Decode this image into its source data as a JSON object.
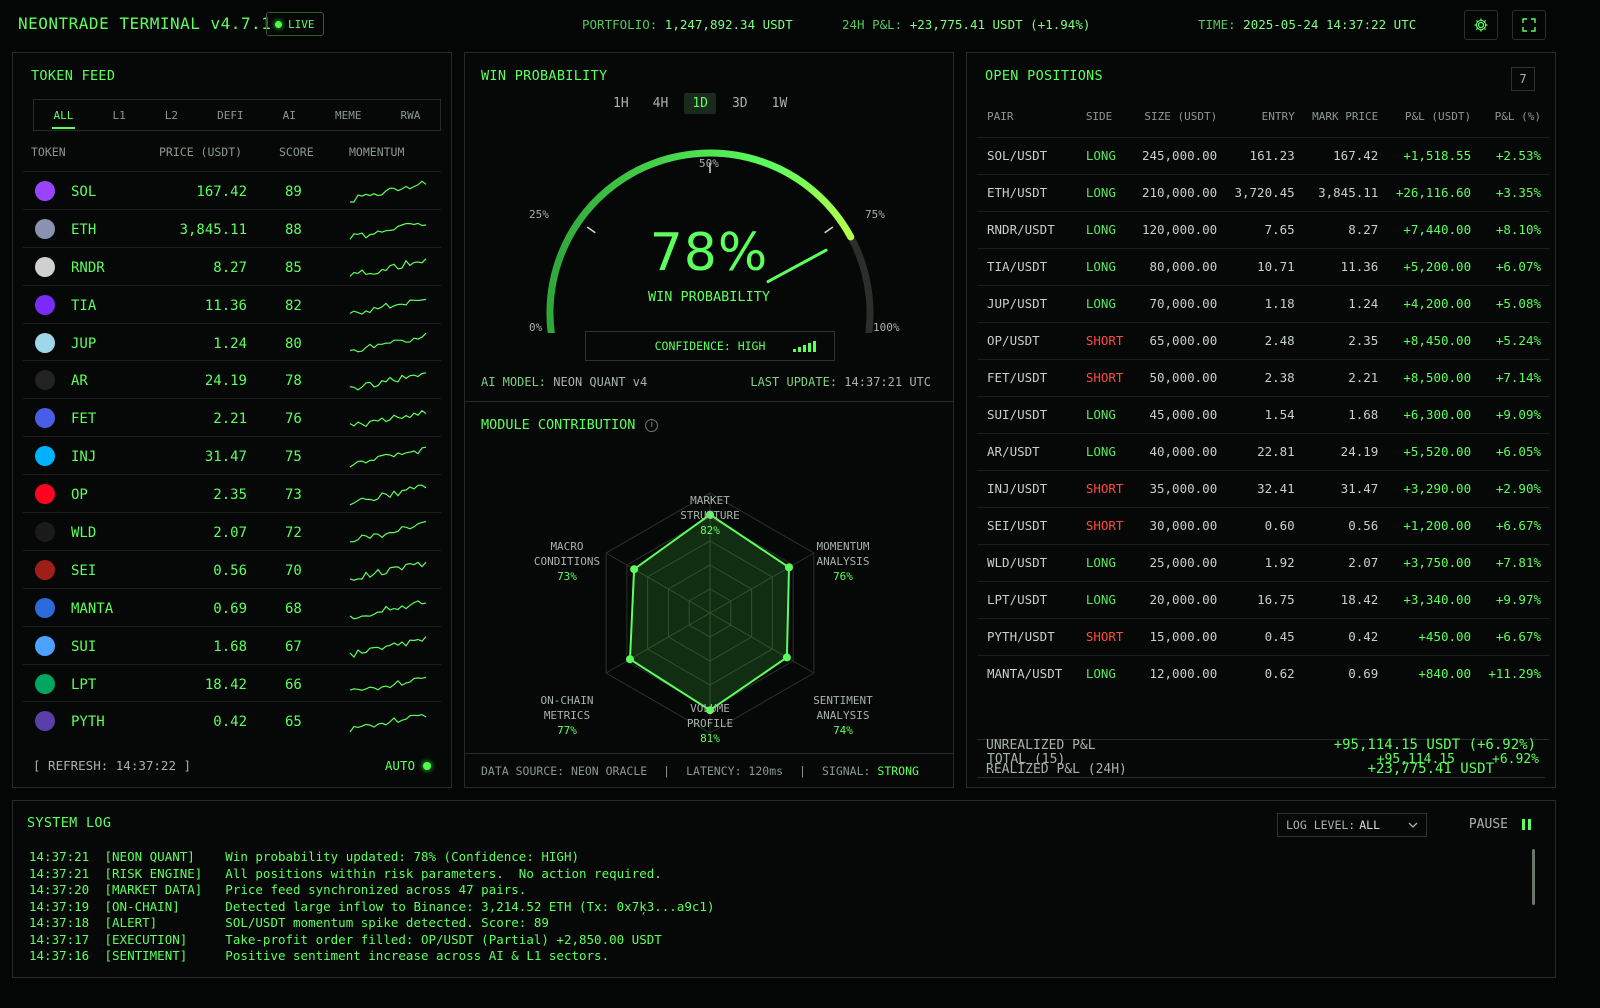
{
  "header": {
    "title": "NEONTRADE TERMINAL v4.7.1",
    "live": "LIVE",
    "portfolio_label": "PORTFOLIO:",
    "portfolio_value": "1,247,892.34 USDT",
    "pnl_label": "24H P&L:",
    "pnl_value": "+23,775.41 USDT (+1.94%)",
    "time_label": "TIME:",
    "time_value": "2025-05-24 14:37:22 UTC",
    "icons": [
      "gear-icon",
      "fullscreen-icon"
    ]
  },
  "token_feed": {
    "title": "TOKEN FEED",
    "tabs": [
      "ALL",
      "L1",
      "L2",
      "DEFI",
      "AI",
      "MEME",
      "RWA"
    ],
    "active_tab": "ALL",
    "columns": [
      "TOKEN",
      "PRICE (USDT)",
      "SCORE",
      "MOMENTUM"
    ],
    "rows": [
      {
        "name": "SOL",
        "price": "167.42",
        "score": "89",
        "color": "#9945ff"
      },
      {
        "name": "ETH",
        "price": "3,845.11",
        "score": "88",
        "color": "#8a92b2"
      },
      {
        "name": "RNDR",
        "price": "8.27",
        "score": "85",
        "color": "#d0d0d0"
      },
      {
        "name": "TIA",
        "price": "11.36",
        "score": "82",
        "color": "#7b2bf9"
      },
      {
        "name": "JUP",
        "price": "1.24",
        "score": "80",
        "color": "#9fd7e8"
      },
      {
        "name": "AR",
        "price": "24.19",
        "score": "78",
        "color": "#222222"
      },
      {
        "name": "FET",
        "price": "2.21",
        "score": "76",
        "color": "#4a5de8"
      },
      {
        "name": "INJ",
        "price": "31.47",
        "score": "75",
        "color": "#00b2ff"
      },
      {
        "name": "OP",
        "price": "2.35",
        "score": "73",
        "color": "#ff0420"
      },
      {
        "name": "WLD",
        "price": "2.07",
        "score": "72",
        "color": "#1a1a1a"
      },
      {
        "name": "SEI",
        "price": "0.56",
        "score": "70",
        "color": "#9e1f19"
      },
      {
        "name": "MANTA",
        "price": "0.69",
        "score": "68",
        "color": "#2a6bdb"
      },
      {
        "name": "SUI",
        "price": "1.68",
        "score": "67",
        "color": "#4da2ff"
      },
      {
        "name": "LPT",
        "price": "18.42",
        "score": "66",
        "color": "#00a55f"
      },
      {
        "name": "PYTH",
        "price": "0.42",
        "score": "65",
        "color": "#5a3fa8"
      }
    ],
    "refresh": "[ REFRESH: 14:37:22 ]",
    "auto": "AUTO"
  },
  "win_probability": {
    "title": "WIN PROBABILITY",
    "timeframes": [
      "1H",
      "4H",
      "1D",
      "3D",
      "1W"
    ],
    "active_timeframe": "1D",
    "value": 78,
    "value_text": "78%",
    "label": "WIN PROBABILITY",
    "scale": [
      "0%",
      "25%",
      "50%",
      "75%",
      "100%"
    ],
    "confidence": "CONFIDENCE: HIGH",
    "model_label": "AI MODEL:",
    "model_value": "NEON QUANT v4",
    "update_label": "LAST UPDATE:",
    "update_value": "14:37:21 UTC"
  },
  "module_contribution": {
    "title": "MODULE CONTRIBUTION",
    "modules": [
      {
        "name1": "MARKET",
        "name2": "STRUCTURE",
        "value": 82,
        "pct": "82%"
      },
      {
        "name1": "MOMENTUM",
        "name2": "ANALYSIS",
        "value": 76,
        "pct": "76%"
      },
      {
        "name1": "SENTIMENT",
        "name2": "ANALYSIS",
        "value": 74,
        "pct": "74%"
      },
      {
        "name1": "VOLUME",
        "name2": "PROFILE",
        "value": 81,
        "pct": "81%"
      },
      {
        "name1": "ON-CHAIN",
        "name2": "METRICS",
        "value": 77,
        "pct": "77%"
      },
      {
        "name1": "MACRO",
        "name2": "CONDITIONS",
        "value": 73,
        "pct": "73%"
      }
    ],
    "footer_source": "DATA SOURCE: NEON ORACLE",
    "footer_latency": "LATENCY: 120ms",
    "footer_signal_label": "SIGNAL:",
    "footer_signal_value": "STRONG",
    "sep": "|"
  },
  "open_positions": {
    "title": "OPEN POSITIONS",
    "count": "7",
    "columns": [
      "PAIR",
      "SIDE",
      "SIZE (USDT)",
      "ENTRY",
      "MARK PRICE",
      "P&L (USDT)",
      "P&L (%)"
    ],
    "rows": [
      [
        "SOL/USDT",
        "LONG",
        "245,000.00",
        "161.23",
        "167.42",
        "+1,518.55",
        "+2.53%"
      ],
      [
        "ETH/USDT",
        "LONG",
        "210,000.00",
        "3,720.45",
        "3,845.11",
        "+26,116.60",
        "+3.35%"
      ],
      [
        "RNDR/USDT",
        "LONG",
        "120,000.00",
        "7.65",
        "8.27",
        "+7,440.00",
        "+8.10%"
      ],
      [
        "TIA/USDT",
        "LONG",
        "80,000.00",
        "10.71",
        "11.36",
        "+5,200.00",
        "+6.07%"
      ],
      [
        "JUP/USDT",
        "LONG",
        "70,000.00",
        "1.18",
        "1.24",
        "+4,200.00",
        "+5.08%"
      ],
      [
        "OP/USDT",
        "SHORT",
        "65,000.00",
        "2.48",
        "2.35",
        "+8,450.00",
        "+5.24%"
      ],
      [
        "FET/USDT",
        "SHORT",
        "50,000.00",
        "2.38",
        "2.21",
        "+8,500.00",
        "+7.14%"
      ],
      [
        "SUI/USDT",
        "LONG",
        "45,000.00",
        "1.54",
        "1.68",
        "+6,300.00",
        "+9.09%"
      ],
      [
        "AR/USDT",
        "LONG",
        "40,000.00",
        "22.81",
        "24.19",
        "+5,520.00",
        "+6.05%"
      ],
      [
        "INJ/USDT",
        "SHORT",
        "35,000.00",
        "32.41",
        "31.47",
        "+3,290.00",
        "+2.90%"
      ],
      [
        "SEI/USDT",
        "SHORT",
        "30,000.00",
        "0.60",
        "0.56",
        "+1,200.00",
        "+6.67%"
      ],
      [
        "WLD/USDT",
        "LONG",
        "25,000.00",
        "1.92",
        "2.07",
        "+3,750.00",
        "+7.81%"
      ],
      [
        "LPT/USDT",
        "LONG",
        "20,000.00",
        "16.75",
        "18.42",
        "+3,340.00",
        "+9.97%"
      ],
      [
        "PYTH/USDT",
        "SHORT",
        "15,000.00",
        "0.45",
        "0.42",
        "+450.00",
        "+6.67%"
      ],
      [
        "MANTA/USDT",
        "LONG",
        "12,000.00",
        "0.62",
        "0.69",
        "+840.00",
        "+11.29%"
      ]
    ],
    "total_label": "TOTAL (15)",
    "total_pnl": "+95,114.15",
    "total_pct": "+6.92%",
    "unrealized_label": "UNREALIZED P&L",
    "unrealized_value": "+95,114.15 USDT (+6.92%)",
    "realized_label": "REALIZED P&L (24H)",
    "realized_value": "+23,775.41 USDT"
  },
  "system_log": {
    "title": "SYSTEM LOG",
    "log_level_label": "LOG LEVEL:",
    "log_level_value": "ALL",
    "pause": "PAUSE",
    "lines": [
      {
        "time": "14:37:21",
        "source": "[NEON QUANT]",
        "message": "Win probability updated: 78% (Confidence: HIGH)"
      },
      {
        "time": "14:37:21",
        "source": "[RISK ENGINE]",
        "message": "All positions within risk parameters.  No action required."
      },
      {
        "time": "14:37:20",
        "source": "[MARKET DATA]",
        "message": "Price feed synchronized across 47 pairs."
      },
      {
        "time": "14:37:19",
        "source": "[ON-CHAIN]",
        "message": "Detected large inflow to Binance: 3,214.52 ETH (Tx: 0x7ķ3...a9c1)"
      },
      {
        "time": "14:37:18",
        "source": "[ALERT]",
        "message": "SOL/USDT momentum spike detected. Score: 89"
      },
      {
        "time": "14:37:17",
        "source": "[EXECUTION]",
        "message": "Take-profit order filled: OP/USDT (Partial) +2,850.00 USDT"
      },
      {
        "time": "14:37:16",
        "source": "[SENTIMENT]",
        "message": "Positive sentiment increase across AI & L1 sectors."
      }
    ]
  }
}
